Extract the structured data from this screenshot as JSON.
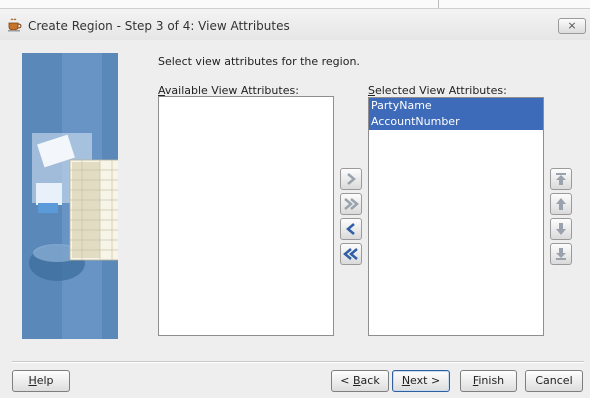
{
  "window": {
    "title": "Create Region - Step 3 of 4: View Attributes",
    "close_label": "⨯"
  },
  "instruction": "Select view attributes for the region.",
  "available": {
    "label_accel": "A",
    "label_rest": "vailable View Attributes:",
    "items": []
  },
  "selected": {
    "label_accel": "S",
    "label_rest": "elected View Attributes:",
    "items": [
      "PartyName",
      "AccountNumber"
    ]
  },
  "shuttle_buttons": [
    "move-right",
    "move-all-right",
    "move-left",
    "move-all-left"
  ],
  "order_buttons": [
    "move-to-top",
    "move-up",
    "move-down",
    "move-to-bottom"
  ],
  "buttons": {
    "help": {
      "accel": "H",
      "rest": "elp"
    },
    "back": {
      "pre": "< ",
      "accel": "B",
      "rest": "ack"
    },
    "next": {
      "accel": "N",
      "rest": "ext >"
    },
    "finish": {
      "accel": "F",
      "rest": "inish"
    },
    "cancel": "Cancel"
  },
  "colors": {
    "selection": "#3d6ab9",
    "accent": "#2f5fa8"
  }
}
